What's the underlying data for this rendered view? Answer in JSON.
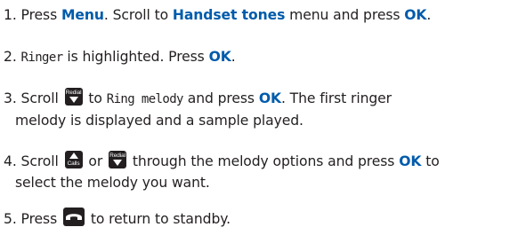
{
  "steps": [
    {
      "number": "1.",
      "press": "Press",
      "menu_key": "Menu",
      "scroll_to": ". Scroll to",
      "menu_name": "Handset tones",
      "menu_and_press": "menu and press",
      "ok_key": "OK",
      "end": "."
    },
    {
      "number": "2.",
      "lcd_text": "Ringer",
      "highlight_text": "is highlighted. Press",
      "ok_key": "OK",
      "end": "."
    },
    {
      "number": "3.",
      "scroll": "Scroll",
      "key_down_label": "Redial",
      "to": "to",
      "lcd_text": "Ring melody",
      "and_press": "and press",
      "ok_key": "OK",
      "rest_line1": ". The first ringer",
      "line2": "melody is displayed and a sample played."
    },
    {
      "number": "4.",
      "scroll": "Scroll",
      "key_up_label": "Calls",
      "or": "or",
      "key_down_label": "Redial",
      "through": "through the melody options and press",
      "ok_key": "OK",
      "to": "to",
      "line2": "select the melody you want."
    },
    {
      "number": "5.",
      "press": "Press",
      "key_icon": "end-call-icon",
      "rest": "to return to standby."
    }
  ],
  "colors": {
    "text": "#231f20",
    "keyword": "#005bab",
    "key_bg": "#231f20"
  }
}
